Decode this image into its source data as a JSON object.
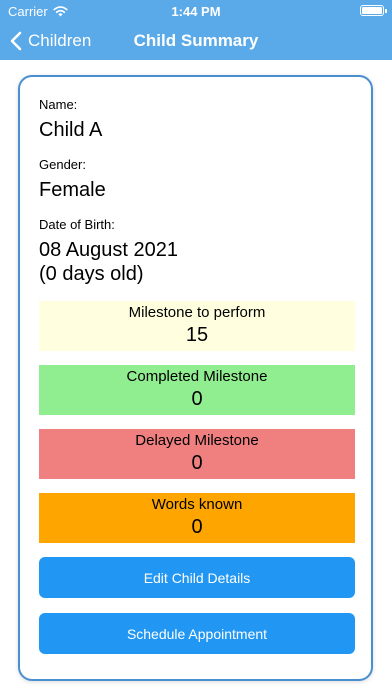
{
  "status_bar": {
    "carrier": "Carrier",
    "time": "1:44 PM"
  },
  "nav": {
    "back_label": "Children",
    "title": "Child Summary"
  },
  "child": {
    "name_label": "Name:",
    "name": "Child A",
    "gender_label": "Gender:",
    "gender": "Female",
    "dob_label": "Date of Birth:",
    "dob": "08 August 2021",
    "age": "(0 days old)"
  },
  "stats": [
    {
      "label": "Milestone to perform",
      "value": "15",
      "color": "#ffffe0"
    },
    {
      "label": "Completed Milestone",
      "value": "0",
      "color": "#90ee90"
    },
    {
      "label": "Delayed Milestone",
      "value": "0",
      "color": "#f08080"
    },
    {
      "label": "Words known",
      "value": "0",
      "color": "#ffa500"
    }
  ],
  "actions": {
    "edit_label": "Edit Child Details",
    "schedule_label": "Schedule Appointment"
  },
  "colors": {
    "header": "#5aa9e8",
    "card_border": "#4a8fd0",
    "button": "#2196f3"
  }
}
